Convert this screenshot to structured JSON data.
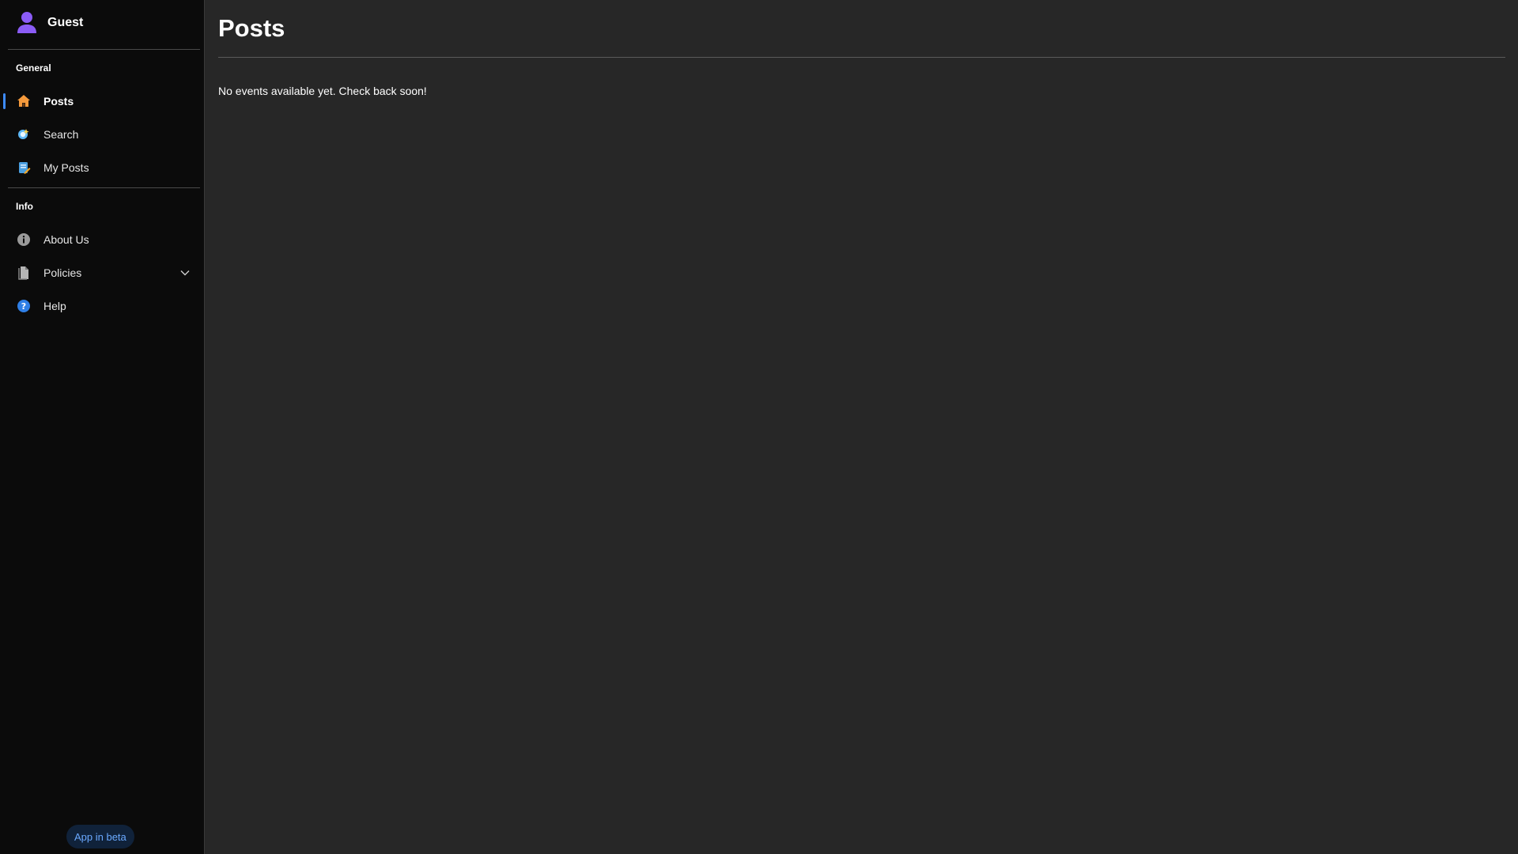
{
  "user": {
    "name": "Guest"
  },
  "sidebar": {
    "sections": [
      {
        "title": "General",
        "items": [
          {
            "label": "Posts",
            "icon": "home-icon",
            "active": true
          },
          {
            "label": "Search",
            "icon": "search-icon"
          },
          {
            "label": "My Posts",
            "icon": "notebook-icon"
          }
        ]
      },
      {
        "title": "Info",
        "items": [
          {
            "label": "About Us",
            "icon": "info-icon"
          },
          {
            "label": "Policies",
            "icon": "document-icon",
            "expandable": true
          },
          {
            "label": "Help",
            "icon": "help-icon"
          }
        ]
      }
    ],
    "beta_label": "App in beta"
  },
  "main": {
    "title": "Posts",
    "empty_message": "No events available yet. Check back soon!"
  },
  "colors": {
    "accent": "#3d8bfd",
    "avatar": "#8b5cf6",
    "sidebar_bg": "#0b0b0b",
    "main_bg": "#272727",
    "beta_text": "#6aa9ff",
    "beta_bg": "#10223a"
  }
}
